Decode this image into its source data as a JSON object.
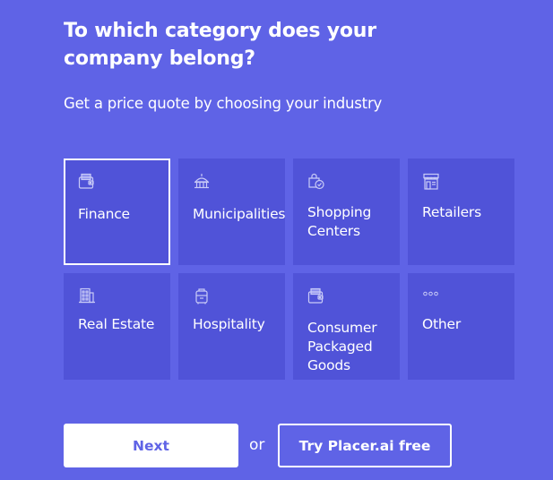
{
  "header": {
    "title": "To which category does your company belong?",
    "subtitle": "Get a price quote by choosing your industry"
  },
  "categories": [
    {
      "label": "Finance",
      "icon": "wallet-icon",
      "selected": true
    },
    {
      "label": "Municipalities",
      "icon": "government-building-icon",
      "selected": false
    },
    {
      "label": "Shopping Centers",
      "icon": "shopping-bag-check-icon",
      "selected": false
    },
    {
      "label": "Retailers",
      "icon": "storefront-icon",
      "selected": false
    },
    {
      "label": "Real Estate",
      "icon": "office-building-icon",
      "selected": false
    },
    {
      "label": "Hospitality",
      "icon": "suitcase-icon",
      "selected": false
    },
    {
      "label": "Consumer Packaged Goods",
      "icon": "wallet-icon",
      "selected": false
    },
    {
      "label": "Other",
      "icon": "ellipsis-icon",
      "selected": false
    }
  ],
  "actions": {
    "next_label": "Next",
    "or_label": "or",
    "try_label": "Try Placer.ai free"
  },
  "colors": {
    "background": "#5f63e6",
    "tile": "#5053d8",
    "text": "#ffffff"
  }
}
